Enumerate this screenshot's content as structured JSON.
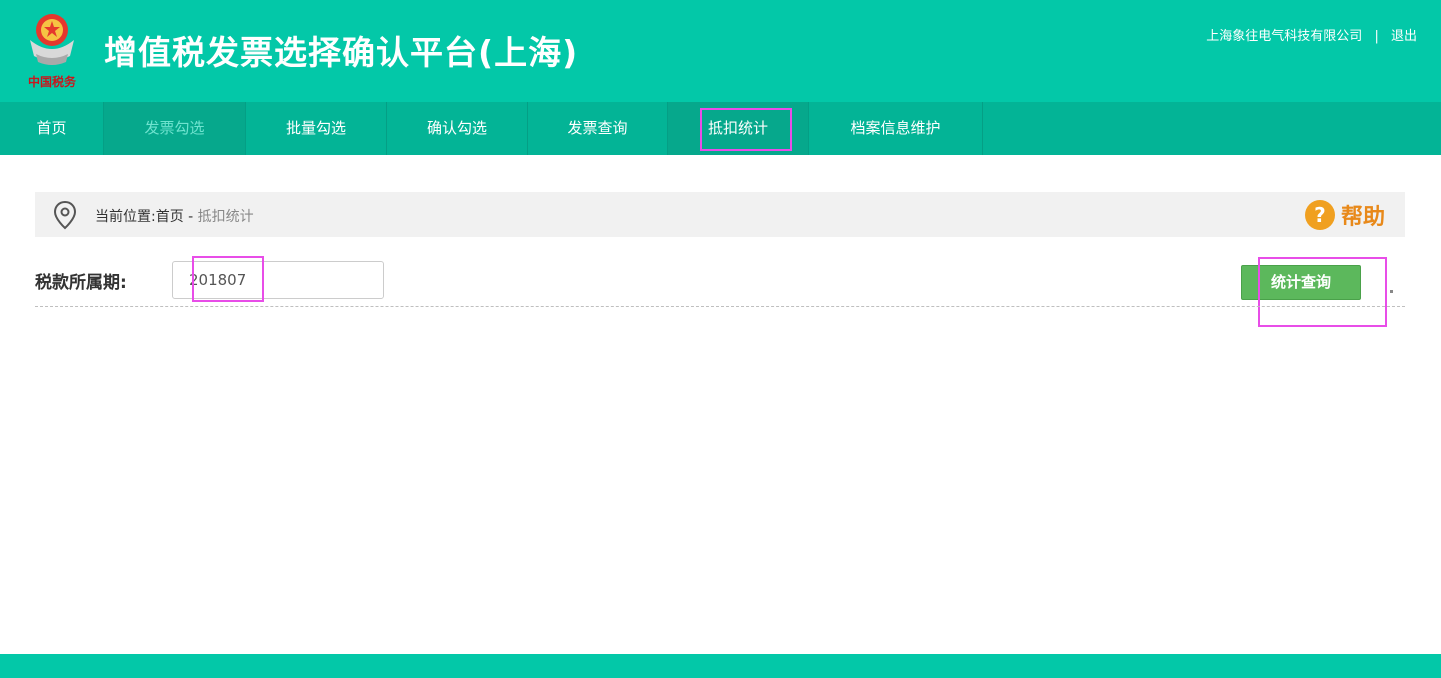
{
  "header": {
    "title": "增值税发票选择确认平台(上海)",
    "company": "上海象往电气科技有限公司",
    "separator": "|",
    "logout": "退出",
    "logo_icon": "tax-emblem-icon",
    "logo_text": "中国税务"
  },
  "nav": {
    "items": [
      {
        "label": "首页"
      },
      {
        "label": "发票勾选"
      },
      {
        "label": "批量勾选"
      },
      {
        "label": "确认勾选"
      },
      {
        "label": "发票查询"
      },
      {
        "label": "抵扣统计"
      },
      {
        "label": "档案信息维护"
      }
    ]
  },
  "breadcrumb": {
    "prefix": "当前位置:首页 - ",
    "current": "抵扣统计",
    "icon": "location-pin-icon"
  },
  "help": {
    "icon": "question-icon",
    "icon_glyph": "?",
    "label": "帮助"
  },
  "query": {
    "label": "税款所属期:",
    "value": "201807",
    "button": "统计查询"
  },
  "colors": {
    "brand": "#03c8a8",
    "nav": "#03b496",
    "button": "#5cb85c",
    "highlight": "#e84de8",
    "help": "#e8891a"
  }
}
